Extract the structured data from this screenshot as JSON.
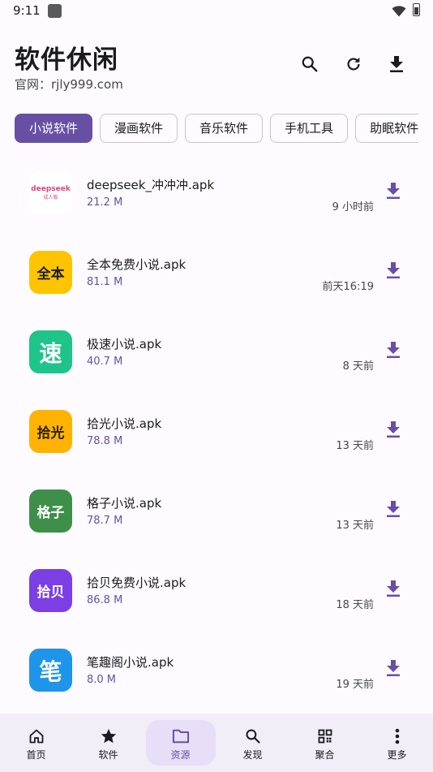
{
  "status_bar": {
    "time": "9:11"
  },
  "header": {
    "title": "软件休闲",
    "subtitle": "官网：rjly999.com",
    "actions": [
      "search-icon",
      "refresh-icon",
      "download-icon"
    ]
  },
  "categories": [
    {
      "label": "小说软件",
      "selected": true
    },
    {
      "label": "漫画软件",
      "selected": false
    },
    {
      "label": "音乐软件",
      "selected": false
    },
    {
      "label": "手机工具",
      "selected": false
    },
    {
      "label": "助眠软件",
      "selected": false
    }
  ],
  "files": [
    {
      "name": "deepseek_冲冲冲.apk",
      "size": "21.2 M",
      "time": "9 小时前",
      "icon_text": "deepseek",
      "icon_sub": "成人版",
      "icon_color": "#ffffff",
      "icon_fg": "#e0457f"
    },
    {
      "name": "全本免费小说.apk",
      "size": "81.1 M",
      "time": "前天16:19",
      "icon_text": "全本",
      "icon_color": "#ffc400",
      "icon_fg": "#1b1b1b"
    },
    {
      "name": "极速小说.apk",
      "size": "40.7 M",
      "time": "8 天前",
      "icon_text": "速",
      "icon_color": "#1fc48a",
      "icon_fg": "#ffffff"
    },
    {
      "name": "拾光小说.apk",
      "size": "78.8 M",
      "time": "13 天前",
      "icon_text": "拾光",
      "icon_color": "#ffb300",
      "icon_fg": "#2b1d0e"
    },
    {
      "name": "格子小说.apk",
      "size": "78.7 M",
      "time": "13 天前",
      "icon_text": "格子",
      "icon_color": "#3e8f4a",
      "icon_fg": "#ffffff"
    },
    {
      "name": "拾贝免费小说.apk",
      "size": "86.8 M",
      "time": "18 天前",
      "icon_text": "拾贝",
      "icon_color": "#7b3fe4",
      "icon_fg": "#ffffff"
    },
    {
      "name": "笔趣阁小说.apk",
      "size": "8.0 M",
      "time": "19 天前",
      "icon_text": "笔",
      "icon_color": "#1e95e8",
      "icon_fg": "#ffffff"
    }
  ],
  "nav": [
    {
      "label": "首页",
      "icon": "home-icon",
      "active": false
    },
    {
      "label": "软件",
      "icon": "star-icon",
      "active": false
    },
    {
      "label": "资源",
      "icon": "folder-icon",
      "active": true
    },
    {
      "label": "发现",
      "icon": "search-icon",
      "active": false
    },
    {
      "label": "聚合",
      "icon": "grid-icon",
      "active": false
    },
    {
      "label": "更多",
      "icon": "more-vertical-icon",
      "active": false
    }
  ],
  "colors": {
    "accent": "#6750a4",
    "background": "#fdfbff",
    "nav_background": "#f2edf6"
  }
}
